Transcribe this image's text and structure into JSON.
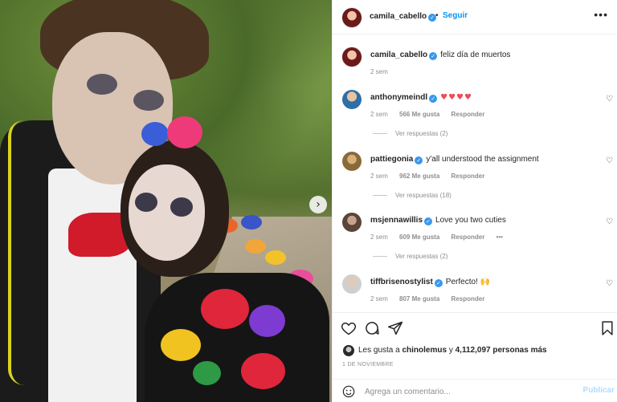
{
  "post": {
    "username": "camila_cabello",
    "separator": "•",
    "follow_label": "Seguir",
    "more_label": "•••",
    "next_label": "›"
  },
  "caption": {
    "username": "camila_cabello",
    "text": "feliz día de muertos",
    "time": "2 sem"
  },
  "comments": [
    {
      "username": "anthonymeindl",
      "text": "♥♥♥♥",
      "time": "2 sem",
      "likes": "566 Me gusta",
      "reply_label": "Responder",
      "replies": "Ver respuestas (2)"
    },
    {
      "username": "pattiegonia",
      "text": "y'all understood the assignment",
      "time": "2 sem",
      "likes": "962 Me gusta",
      "reply_label": "Responder",
      "replies": "Ver respuestas (18)"
    },
    {
      "username": "msjennawillis",
      "text": "Love you two cuties",
      "time": "2 sem",
      "likes": "609 Me gusta",
      "reply_label": "Responder",
      "options_label": "•••",
      "replies": "Ver respuestas (2)"
    },
    {
      "username": "tiffbrisenostylist",
      "text": "Perfecto! 🙌",
      "time": "2 sem",
      "likes": "807 Me gusta",
      "reply_label": "Responder"
    }
  ],
  "likes_line": {
    "prefix": "Les gusta a ",
    "user": "chinolemus",
    "middle": " y ",
    "count": "4,112,097 personas más"
  },
  "date": "1 DE NOVIEMBRE",
  "composer": {
    "placeholder": "Agrega un comentario...",
    "post_label": "Publicar"
  },
  "colors": {
    "link_blue": "#0095f6",
    "verified_blue": "#3897f0",
    "heart_red": "#ed4956",
    "muted_gray": "#8e8e8e"
  },
  "icons": [
    "heart-icon",
    "comment-icon",
    "share-icon",
    "bookmark-icon",
    "emoji-icon",
    "verified-icon",
    "next-arrow-icon",
    "more-options-icon"
  ]
}
